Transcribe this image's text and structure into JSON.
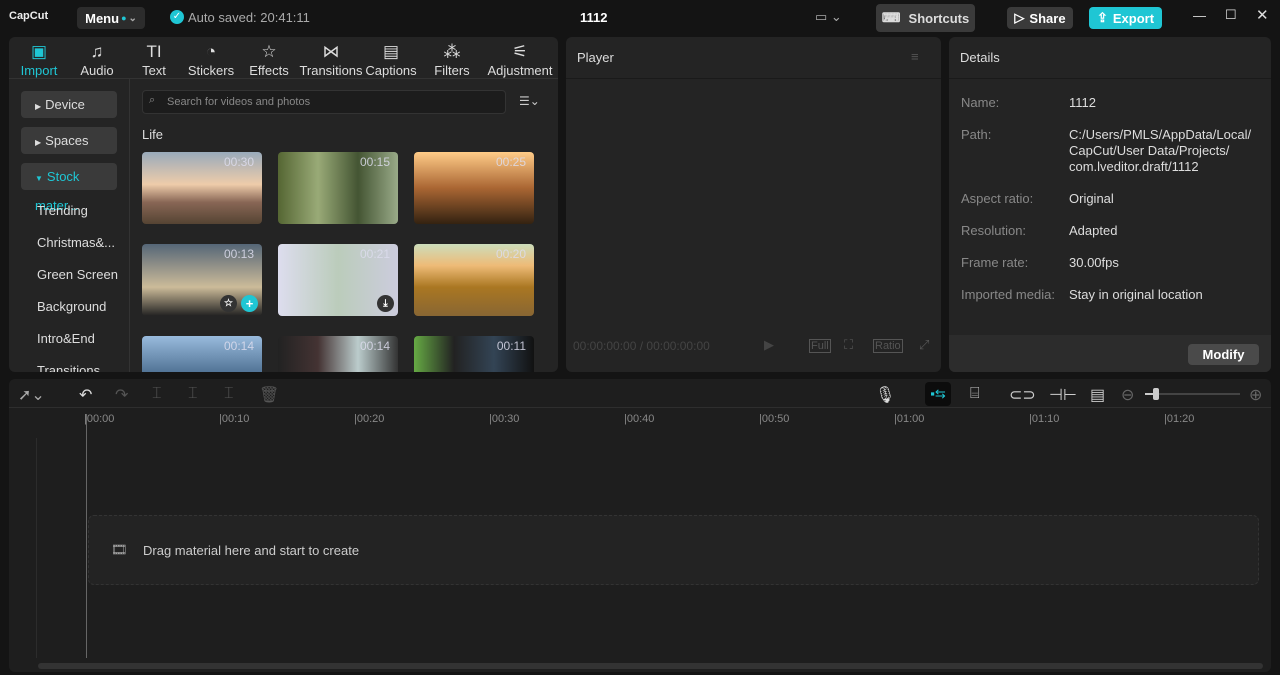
{
  "app": {
    "logo": "CapCut",
    "menu": "Menu",
    "autosave": "Auto saved: 20:41:11",
    "title": "1112",
    "shortcuts": "Shortcuts",
    "share": "Share",
    "export": "Export",
    "accent": "#1fc6d4"
  },
  "toolbar": [
    {
      "label": "Import",
      "icon": "import-icon"
    },
    {
      "label": "Audio",
      "icon": "audio-icon"
    },
    {
      "label": "Text",
      "icon": "text-icon"
    },
    {
      "label": "Stickers",
      "icon": "sticker-icon"
    },
    {
      "label": "Effects",
      "icon": "effects-icon"
    },
    {
      "label": "Transitions",
      "icon": "transitions-icon"
    },
    {
      "label": "Captions",
      "icon": "captions-icon"
    },
    {
      "label": "Filters",
      "icon": "filters-icon"
    },
    {
      "label": "Adjustment",
      "icon": "adjustment-icon"
    }
  ],
  "sidebar": {
    "groups": [
      "Device",
      "Spaces",
      "Stock mater..."
    ],
    "items": [
      "Trending",
      "Christmas&...",
      "Green Screen",
      "Background",
      "Intro&End",
      "Transitions"
    ]
  },
  "media": {
    "search_placeholder": "Search for videos and photos",
    "section": "Life",
    "clips": [
      "00:30",
      "00:15",
      "00:25",
      "00:13",
      "00:21",
      "00:20",
      "00:14",
      "00:14",
      "00:11"
    ]
  },
  "player": {
    "title": "Player",
    "timecode": "00:00:00:00 / 00:00:00:00",
    "full": "Full",
    "ratio": "Ratio"
  },
  "details": {
    "title": "Details",
    "rows": [
      {
        "label": "Name:",
        "value": "1112"
      },
      {
        "label": "Path:",
        "value": "C:/Users/PMLS/AppData/Local/ CapCut/User Data/Projects/ com.lveditor.draft/1112"
      },
      {
        "label": "Aspect ratio:",
        "value": "Original"
      },
      {
        "label": "Resolution:",
        "value": "Adapted"
      },
      {
        "label": "Frame rate:",
        "value": "30.00fps"
      },
      {
        "label": "Imported media:",
        "value": "Stay in original location"
      }
    ],
    "modify": "Modify"
  },
  "timeline": {
    "ticks": [
      "00:00",
      "00:10",
      "00:20",
      "00:30",
      "00:40",
      "00:50",
      "01:00",
      "01:10",
      "01:20"
    ],
    "drop_hint": "Drag material here and start to create",
    "zoom_level": 0.08
  }
}
